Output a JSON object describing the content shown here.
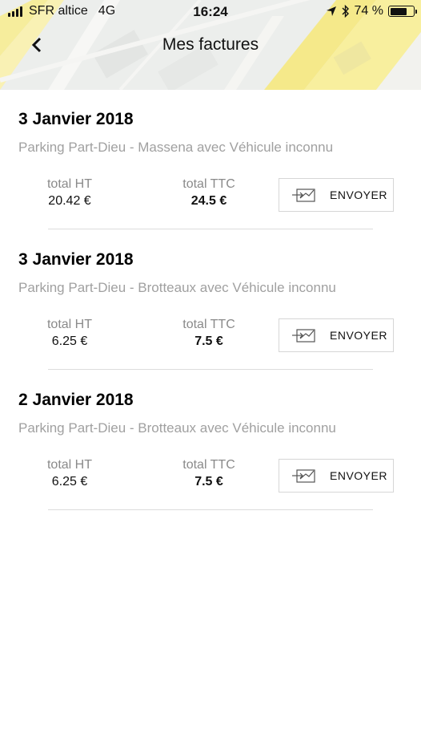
{
  "status_bar": {
    "carrier": "SFR altice",
    "network": "4G",
    "time": "16:24",
    "battery_text": "74 %",
    "battery_level": 0.74
  },
  "header": {
    "title": "Mes factures",
    "back_icon": "chevron-left-icon"
  },
  "invoices": [
    {
      "date": "3 Janvier 2018",
      "description": "Parking Part-Dieu - Massena avec Véhicule inconnu",
      "total_ht_label": "total HT",
      "total_ht": "20.42 €",
      "total_ttc_label": "total TTC",
      "total_ttc": "24.5 €",
      "send_label": "ENVOYER"
    },
    {
      "date": "3 Janvier 2018",
      "description": "Parking Part-Dieu - Brotteaux avec Véhicule inconnu",
      "total_ht_label": "total HT",
      "total_ht": "6.25 €",
      "total_ttc_label": "total TTC",
      "total_ttc": "7.5 €",
      "send_label": "ENVOYER"
    },
    {
      "date": "2 Janvier 2018",
      "description": "Parking Part-Dieu - Brotteaux avec Véhicule inconnu",
      "total_ht_label": "total HT",
      "total_ht": "6.25 €",
      "total_ttc_label": "total TTC",
      "total_ttc": "7.5 €",
      "send_label": "ENVOYER"
    }
  ],
  "colors": {
    "accent_yellow": "#f7e98a",
    "secondary_text": "#a0a0a0",
    "divider": "#dcdcdc"
  }
}
